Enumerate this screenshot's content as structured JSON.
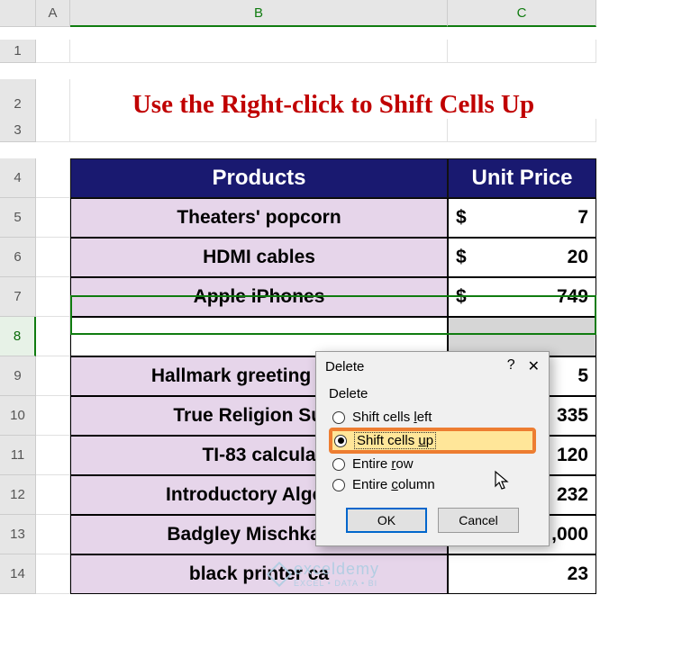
{
  "columns": {
    "blank": "",
    "a": "A",
    "b": "B",
    "c": "C"
  },
  "rows": {
    "r1": "1",
    "r2": "2",
    "r3": "3",
    "r4": "4",
    "r5": "5",
    "r6": "6",
    "r7": "7",
    "r8": "8",
    "r9": "9",
    "r10": "10",
    "r11": "11",
    "r12": "12",
    "r13": "13",
    "r14": "14"
  },
  "title": "Use the Right-click to Shift Cells Up",
  "headers": {
    "products": "Products",
    "unit_price": "Unit Price"
  },
  "products": [
    "Theaters' popcorn",
    "HDMI cables",
    "Apple iPhones",
    "",
    "Hallmark greeting cards",
    "True Religion Supe",
    "TI-83 calcula",
    "Introductory Algebra",
    "Badgley Mischka we",
    "black printer ca"
  ],
  "currency": "$",
  "prices": [
    "7",
    "20",
    "749",
    "",
    "5",
    "335",
    "120",
    "232",
    ",000",
    "23"
  ],
  "dialog": {
    "title": "Delete",
    "help": "?",
    "close": "✕",
    "group": "Delete",
    "opt_left": "Shift cells left",
    "opt_up": "Shift cells up",
    "opt_row": "Entire row",
    "opt_col": "Entire column",
    "ok": "OK",
    "cancel": "Cancel"
  },
  "watermark": {
    "brand": "exceldemy",
    "tagline": "EXCEL • DATA • BI"
  }
}
